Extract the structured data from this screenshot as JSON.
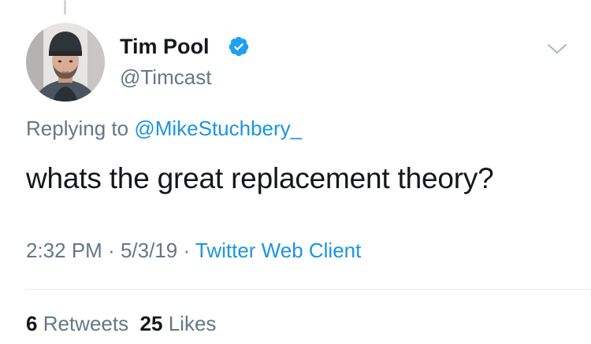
{
  "author": {
    "display_name": "Tim Pool",
    "handle": "@Timcast",
    "verified": true,
    "avatar": "avatar-photo"
  },
  "tweet": {
    "reply_prefix": "Replying to ",
    "reply_to": "@MikeStuchbery_",
    "text": "whats the great replacement theory?",
    "time": "2:32 PM",
    "date": "5/3/19",
    "separator": " · ",
    "client": "Twitter Web Client"
  },
  "stats": {
    "retweets_count": "6",
    "retweets_label": "Retweets",
    "likes_count": "25",
    "likes_label": "Likes"
  },
  "icons": {
    "verified": "verified-badge-icon",
    "menu": "chevron-down-icon"
  },
  "colors": {
    "link": "#1b95e0",
    "secondary_text": "#657786",
    "primary_text": "#14171a",
    "verified": "#1da1f2"
  }
}
